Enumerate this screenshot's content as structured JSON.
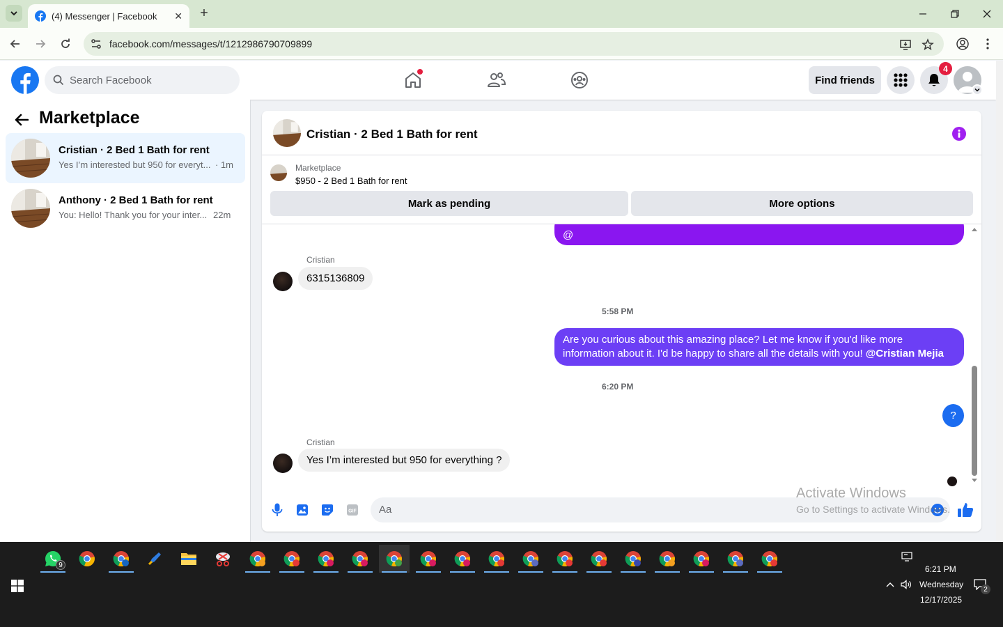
{
  "browser": {
    "tab_title": "(4) Messenger | Facebook",
    "url": "facebook.com/messages/t/1212986790709899"
  },
  "header": {
    "search_placeholder": "Search Facebook",
    "find_friends_label": "Find friends",
    "notification_count": "4"
  },
  "sidebar": {
    "title": "Marketplace",
    "conversations": [
      {
        "name": "Cristian · 2 Bed 1 Bath for rent",
        "preview": "Yes I’m interested but 950 for everyt...",
        "time": "· 1m",
        "active": true
      },
      {
        "name": "Anthony · 2 Bed 1 Bath for rent",
        "preview": "You: Hello! Thank you for your inter...",
        "time": "22m",
        "active": false
      }
    ]
  },
  "chat": {
    "title": "Cristian · 2 Bed 1 Bath for rent",
    "listing": {
      "label": "Marketplace",
      "price_title": "$950 - 2 Bed 1 Bath for rent",
      "mark_pending_label": "Mark as pending",
      "more_options_label": "More options"
    },
    "messages": {
      "partial_out_text": "@",
      "sender_1": "Cristian",
      "phone_message": "6315136809",
      "time_1": "5:58 PM",
      "outgoing_line_1": "Are you curious about this amazing place? Let me know if you'd like more",
      "outgoing_line_2": "information about it. I'd be happy to share all the details with you!",
      "outgoing_mention": "@Cristian Mejia",
      "time_2": "6:20 PM",
      "question_bubble": "?",
      "sender_2": "Cristian",
      "last_incoming": "Yes I’m interested but 950 for everything ?"
    },
    "composer": {
      "placeholder": "Aa",
      "gif_label": "GIF"
    }
  },
  "watermark": {
    "line1": "Activate Windows",
    "line2": "Go to Settings to activate Windows."
  },
  "taskbar": {
    "whatsapp_badge": "9",
    "clock_time": "6:21 PM",
    "clock_day": "Wednesday",
    "clock_date": "12/17/2025",
    "action_center_badge": "2"
  },
  "colors": {
    "fb_blue": "#1877f2",
    "bubble_purple": "#8a16f0",
    "bubble_violet": "#6c3ff5",
    "info_purple": "#a020f0",
    "notification_red": "#e41e3f"
  }
}
